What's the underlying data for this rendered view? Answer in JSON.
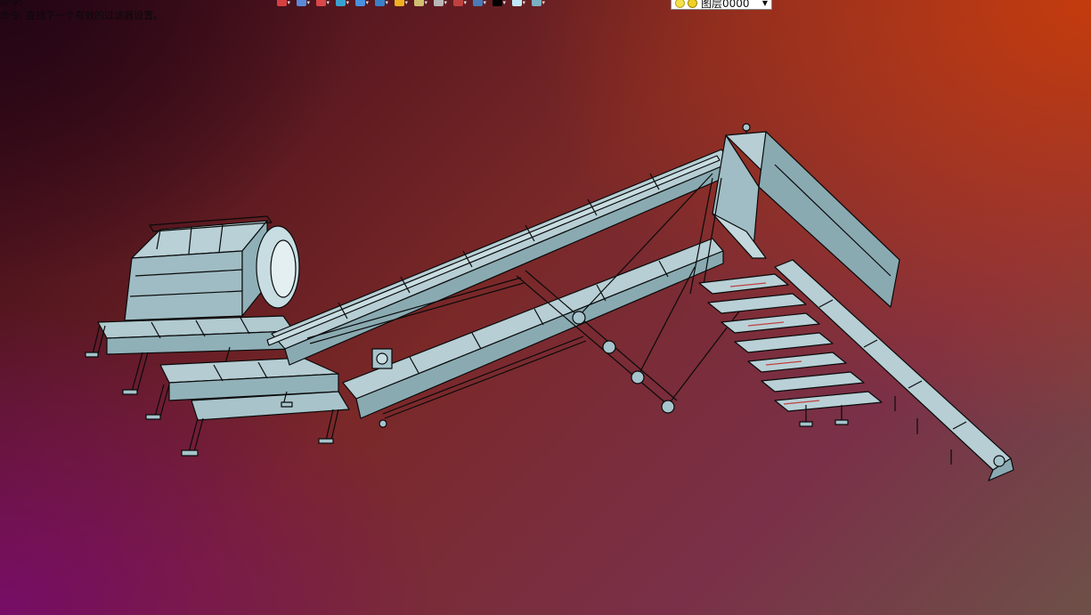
{
  "status": {
    "top_line": "命令:",
    "message": "命令: 查找下一个有效的过滤器设置。"
  },
  "toolbar": {
    "buttons": [
      {
        "icon": "import-icon",
        "color": "#d84040"
      },
      {
        "icon": "view-icon",
        "color": "#5a8ad8"
      },
      {
        "icon": "pencil-icon",
        "color": "#d84848"
      },
      {
        "icon": "box-icon",
        "color": "#3aa0d0"
      },
      {
        "icon": "cube-icon",
        "color": "#4a90e0"
      },
      {
        "icon": "solid-icon",
        "color": "#3a80c8"
      },
      {
        "icon": "sun-icon",
        "color": "#f0b020"
      },
      {
        "icon": "render-icon",
        "color": "#d0c070"
      },
      {
        "icon": "rotate-icon",
        "color": "#b8b8b8"
      },
      {
        "icon": "section-icon",
        "color": "#c04040"
      },
      {
        "icon": "monitor-icon",
        "color": "#4a7ab8"
      },
      {
        "icon": "color-black-icon",
        "color": "#000000"
      },
      {
        "icon": "color-white-icon",
        "color": "#bfe8f8"
      },
      {
        "icon": "layers-icon",
        "color": "#7ab0c0"
      }
    ],
    "layer_name": "图层0000"
  },
  "viewport": {
    "model_color": "#a6c4cc",
    "edge_color": "#0a0a0a"
  }
}
